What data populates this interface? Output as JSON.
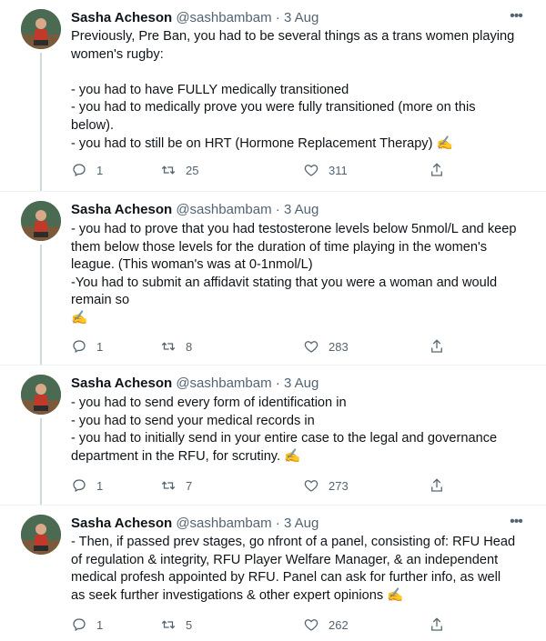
{
  "author": {
    "name": "Sasha Acheson",
    "handle": "@sashbambam"
  },
  "tweets": [
    {
      "date": "· 3 Aug",
      "text": "Previously, Pre Ban, you had to be several things as a trans women playing women's rugby:\n\n- you had to have FULLY medically transitioned\n- you had to medically prove you were fully transitioned (more on this below).\n- you had to still be on HRT (Hormone Replacement Therapy) ✍",
      "replies": "1",
      "retweets": "25",
      "likes": "311"
    },
    {
      "date": "· 3 Aug",
      "text": "- you had to prove that you had testosterone levels below 5nmol/L and keep them below those levels for the duration of time playing in the women's league. (This woman's was at 0-1nmol/L)\n-You had to submit an affidavit stating that you were a woman and would remain so\n✍",
      "replies": "1",
      "retweets": "8",
      "likes": "283"
    },
    {
      "date": "· 3 Aug",
      "text": "- you had to send every form of identification in\n- you had to send your medical records in\n- you had to initially send in your entire case to the legal and governance department in the RFU, for scrutiny. ✍",
      "replies": "1",
      "retweets": "7",
      "likes": "273"
    },
    {
      "date": "· 3 Aug",
      "text": "- Then, if passed prev stages, go nfront of a panel, consisting of: RFU Head of regulation & integrity, RFU Player Welfare Manager, & an independent medical profesh appointed by RFU. Panel can ask for further info, as well as seek further investigations & other expert opinions ✍",
      "replies": "1",
      "retweets": "5",
      "likes": "262"
    }
  ]
}
